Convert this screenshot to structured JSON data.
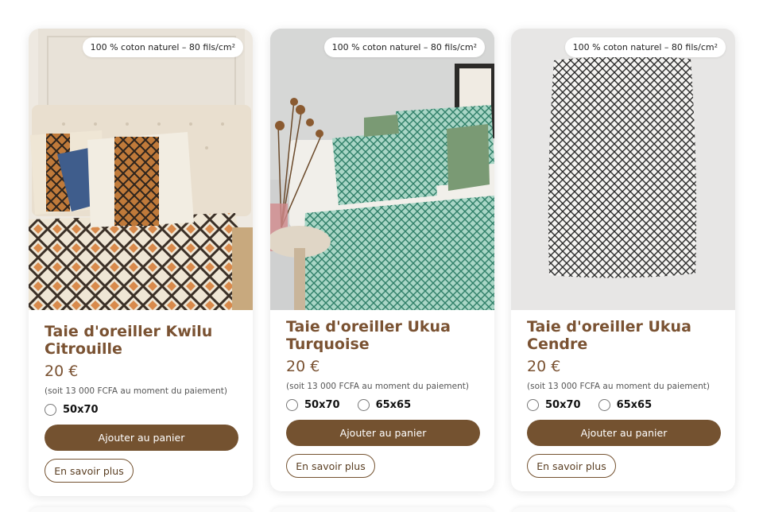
{
  "products": [
    {
      "badge": "100 % coton naturel – 80 fils/cm²",
      "title": "Taie d'oreiller Kwilu Citrouille",
      "price": "20 €",
      "note": "(soit 13 000 FCFA au moment du paiement)",
      "sizes": [
        "50x70"
      ],
      "cart_label": "Ajouter au panier",
      "more_label": "En savoir plus"
    },
    {
      "badge": "100 % coton naturel – 80 fils/cm²",
      "title": "Taie d'oreiller Ukua Turquoise",
      "price": "20 €",
      "note": "(soit 13 000 FCFA au moment du paiement)",
      "sizes": [
        "50x70",
        "65x65"
      ],
      "cart_label": "Ajouter au panier",
      "more_label": "En savoir plus"
    },
    {
      "badge": "100 % coton naturel – 80 fils/cm²",
      "title": "Taie d'oreiller Ukua Cendre",
      "price": "20 €",
      "note": "(soit 13 000 FCFA au moment du paiement)",
      "sizes": [
        "50x70",
        "65x65"
      ],
      "cart_label": "Ajouter au panier",
      "more_label": "En savoir plus"
    }
  ],
  "colors": {
    "accent": "#745230",
    "title": "#7a5232"
  }
}
